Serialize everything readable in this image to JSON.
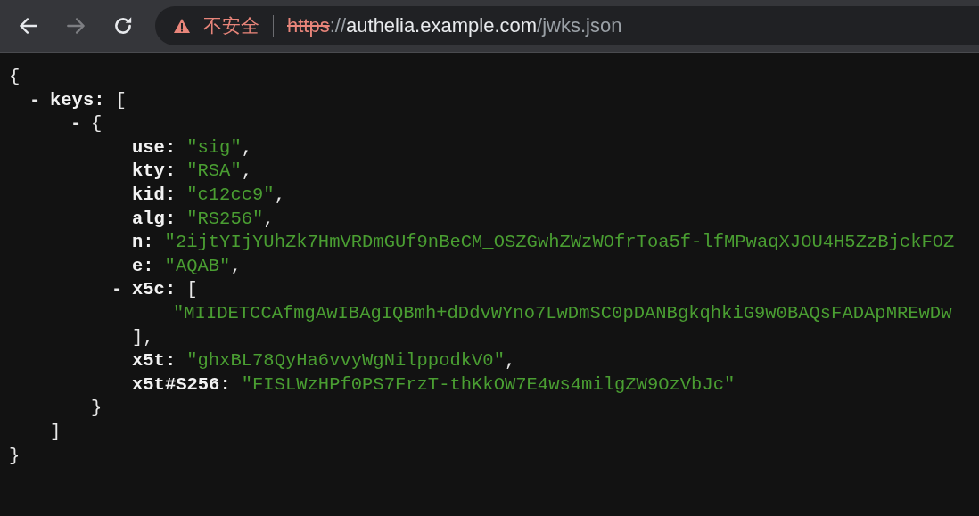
{
  "toolbar": {
    "buttons": [
      {
        "kind": "back",
        "disabled": false
      },
      {
        "kind": "forward",
        "disabled": true
      },
      {
        "kind": "reload",
        "disabled": false
      }
    ],
    "address_bar": {
      "security_label": "不安全",
      "scheme": "https",
      "separator": "://",
      "host": "authelia.example.com",
      "path": "/jwks.json"
    }
  },
  "json_viewer": {
    "root": {
      "open": "{",
      "close": "}",
      "children": [
        {
          "toggle": "-",
          "key": "keys:",
          "open": "[",
          "close": "]",
          "expanded": true,
          "children": [
            {
              "toggle": "-",
              "open": "{",
              "close": "}",
              "expanded": true,
              "children": [
                {
                  "key": "use:",
                  "value": "\"sig\"",
                  "punct": ","
                },
                {
                  "key": "kty:",
                  "value": "\"RSA\"",
                  "punct": ","
                },
                {
                  "key": "kid:",
                  "value": "\"c12cc9\"",
                  "punct": ","
                },
                {
                  "key": "alg:",
                  "value": "\"RS256\"",
                  "punct": ","
                },
                {
                  "key": "n:",
                  "value": "\"2ijtYIjYUhZk7HmVRDmGUf9nBeCM_OSZGwhZWzWOfrToa5f-lfMPwaqXJOU4H5ZzBjckFOZ"
                },
                {
                  "key": "e:",
                  "value": "\"AQAB\"",
                  "punct": ","
                },
                {
                  "toggle": "-",
                  "key": "x5c:",
                  "open": "[",
                  "close": "],",
                  "expanded": true,
                  "children": [
                    {
                      "value": "\"MIIDETCCAfmgAwIBAgIQBmh+dDdvWYno7LwDmSC0pDANBgkqhkiG9w0BAQsFADApMREwDw"
                    }
                  ]
                },
                {
                  "key": "x5t:",
                  "value": "\"ghxBL78QyHa6vvyWgNilppodkV0\"",
                  "punct": ","
                },
                {
                  "key": "x5t#S256:",
                  "value": "\"FISLWzHPf0PS7FrzT-thKkOW7E4ws4milgZW9OzVbJc\""
                }
              ]
            }
          ]
        }
      ]
    }
  }
}
